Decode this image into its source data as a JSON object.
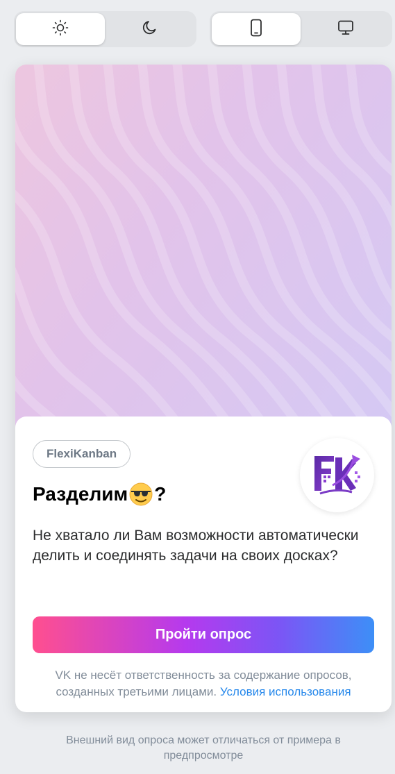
{
  "theme_switch": {
    "options": [
      {
        "icon": "sun-icon",
        "selected": true
      },
      {
        "icon": "moon-icon",
        "selected": false
      }
    ]
  },
  "device_switch": {
    "options": [
      {
        "icon": "phone-icon",
        "selected": true
      },
      {
        "icon": "desktop-icon",
        "selected": false
      }
    ]
  },
  "colors": {
    "page_bg": "#ebedf0",
    "accent_link": "#2688eb",
    "button_gradient": [
      "#ff4f8f",
      "#b53aee",
      "#7c55f5",
      "#3d8ff7"
    ]
  },
  "survey": {
    "brand_chip": "FlexiKanban",
    "logo_icon": "flexikanban-logo-icon",
    "title_text": "Разделим",
    "title_emoji": "😎",
    "title_suffix": "?",
    "description": "Не хватало ли Вам возможности автоматически делить и соединять задачи на своих досках?",
    "button_label": "Пройти опрос",
    "disclaimer_text": "VK не несёт ответственность за содержание опросов, созданных третьими лицами.",
    "disclaimer_link": "Условия использования"
  },
  "footnote": "Внешний вид опроса может отличаться от примера в предпросмотре"
}
